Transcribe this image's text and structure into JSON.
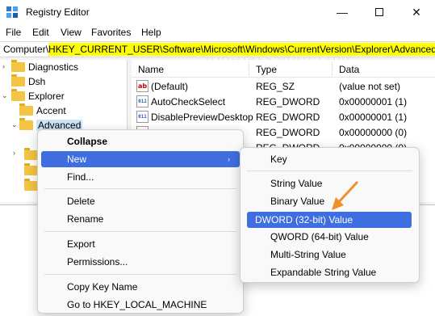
{
  "window": {
    "title": "Registry Editor"
  },
  "menubar": {
    "items": [
      "File",
      "Edit",
      "View",
      "Favorites",
      "Help"
    ]
  },
  "watermark": "top-password.com",
  "address": {
    "label": "Computer\\",
    "path": "HKEY_CURRENT_USER\\Software\\Microsoft\\Windows\\CurrentVersion\\Explorer\\Advanced"
  },
  "tree": {
    "items": [
      {
        "label": "Diagnostics",
        "expanded": false
      },
      {
        "label": "Dsh"
      },
      {
        "label": "Explorer",
        "expanded": true
      },
      {
        "label": "Accent"
      },
      {
        "label": "Advanced",
        "expanded": true,
        "selected": true
      }
    ]
  },
  "list": {
    "columns": [
      "Name",
      "Type",
      "Data"
    ],
    "rows": [
      {
        "name": "(Default)",
        "type": "REG_SZ",
        "data": "(value not set)",
        "icon": "string-value-icon"
      },
      {
        "name": "AutoCheckSelect",
        "type": "REG_DWORD",
        "data": "0x00000001 (1)",
        "icon": "dword-value-icon"
      },
      {
        "name": "DisablePreviewDesktop",
        "type": "REG_DWORD",
        "data": "0x00000001 (1)",
        "icon": "dword-value-icon"
      },
      {
        "name": "",
        "type": "REG_DWORD",
        "data": "0x00000000 (0)",
        "icon": "dword-value-icon"
      },
      {
        "name": "",
        "type": "REG_DWORD",
        "data": "0x00000000 (0)",
        "icon": "dword-value-icon"
      }
    ]
  },
  "context_menu": {
    "items": [
      "Collapse",
      "New",
      "Find...",
      "Delete",
      "Rename",
      "Export",
      "Permissions...",
      "Copy Key Name",
      "Go to HKEY_LOCAL_MACHINE"
    ],
    "highlighted": "New",
    "submenu_arrow": "›"
  },
  "new_submenu": {
    "items": [
      "Key",
      "String Value",
      "Binary Value",
      "DWORD (32-bit) Value",
      "QWORD (64-bit) Value",
      "Multi-String Value",
      "Expandable String Value"
    ],
    "highlighted": "DWORD (32-bit) Value"
  },
  "colors": {
    "highlight": "#3f6ee0",
    "address_highlight": "#ffff00",
    "annotation_arrow": "#f0902a",
    "folder": "#f4c542"
  }
}
